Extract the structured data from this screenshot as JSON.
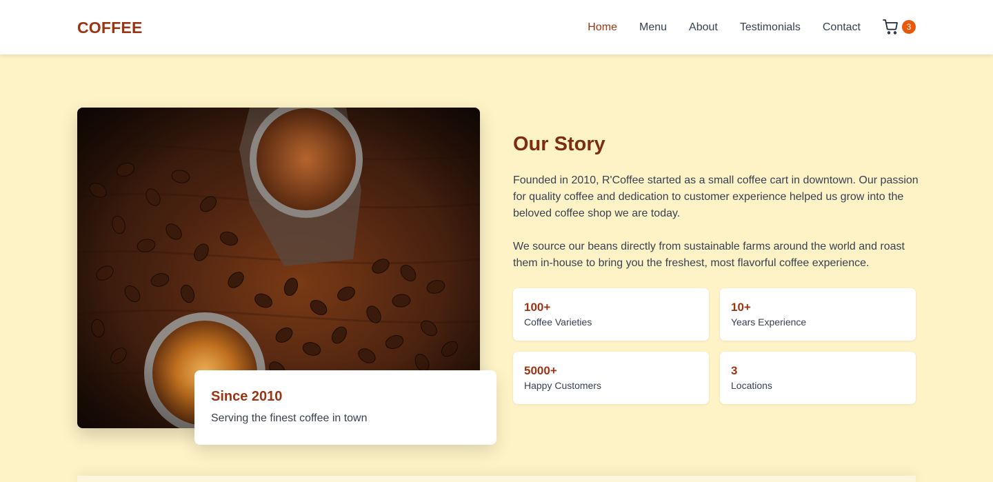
{
  "nav": {
    "logo": "COFFEE",
    "links": [
      "Home",
      "Menu",
      "About",
      "Testimonials",
      "Contact"
    ],
    "active_link": "Home",
    "cart_count": "3"
  },
  "story": {
    "title": "Our Story",
    "paragraphs": [
      "Founded in 2010, R'Coffee started as a small coffee cart in downtown. Our passion for quality coffee and dedication to customer experience helped us grow into the beloved coffee shop we are today.",
      "We source our beans directly from sustainable farms around the world and roast them in-house to bring you the freshest, most flavorful coffee experience."
    ],
    "stats": [
      {
        "value": "100+",
        "label": "Coffee Varieties"
      },
      {
        "value": "10+",
        "label": "Years Experience"
      },
      {
        "value": "5000+",
        "label": "Happy Customers"
      },
      {
        "value": "3",
        "label": "Locations"
      }
    ]
  },
  "since_card": {
    "title": "Since 2010",
    "text": "Serving the finest coffee in town"
  },
  "colors": {
    "brand": "#9a3412",
    "background": "#fef3c7",
    "badge": "#ea580c"
  },
  "icons": {
    "cart": "shopping-cart-icon"
  }
}
